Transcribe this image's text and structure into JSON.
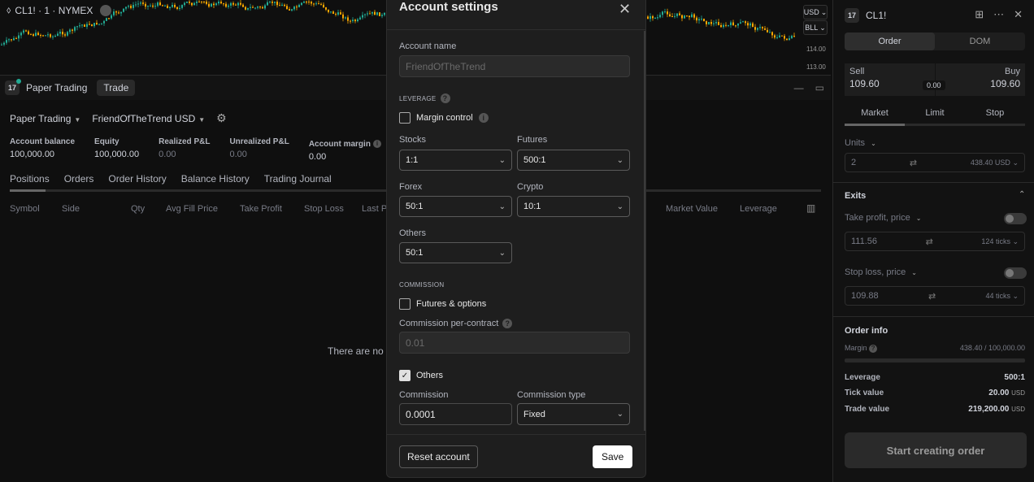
{
  "chart": {
    "symbol": "CL1! · 1 · NYMEX",
    "currency_btn": "USD",
    "unit_btn": "BLL",
    "price_ticks": [
      "114.00",
      "113.00"
    ]
  },
  "panel": {
    "title": "Paper Trading",
    "trade_tab": "Trade",
    "account_type": "Paper Trading",
    "account_name": "FriendOfTheTrend USD",
    "stats": [
      {
        "label": "Account balance",
        "value": "100,000.00",
        "dim": false
      },
      {
        "label": "Equity",
        "value": "100,000.00",
        "dim": false
      },
      {
        "label": "Realized P&L",
        "value": "0.00",
        "dim": true
      },
      {
        "label": "Unrealized P&L",
        "value": "0.00",
        "dim": true
      },
      {
        "label": "Account margin",
        "value": "0.00",
        "dim": false
      }
    ],
    "tabs": [
      "Positions",
      "Orders",
      "Order History",
      "Balance History",
      "Trading Journal"
    ],
    "columns": [
      "Symbol",
      "Side",
      "Qty",
      "Avg Fill Price",
      "Take Profit",
      "Stop Loss",
      "Last P",
      "Market Value",
      "Leverage"
    ],
    "empty_text": "There are no c"
  },
  "order": {
    "symbol": "CL1!",
    "segments": [
      "Order",
      "DOM"
    ],
    "sell_label": "Sell",
    "sell_price": "109.60",
    "buy_label": "Buy",
    "buy_price": "109.60",
    "spread": "0.00",
    "order_types": [
      "Market",
      "Limit",
      "Stop"
    ],
    "units_label": "Units",
    "units_value": "2",
    "units_suffix": "438.40",
    "units_currency": "USD",
    "exits_label": "Exits",
    "tp_label": "Take profit, price",
    "tp_value": "111.56",
    "tp_ticks": "124 ticks",
    "sl_label": "Stop loss, price",
    "sl_value": "109.88",
    "sl_ticks": "44 ticks",
    "info_title": "Order info",
    "margin_label": "Margin",
    "margin_value": "438.40 / 100,000.00",
    "leverage_label": "Leverage",
    "leverage_value": "500:1",
    "tick_label": "Tick value",
    "tick_value": "20.00",
    "trade_label": "Trade value",
    "trade_value": "219,200.00",
    "currency": "USD",
    "start_btn": "Start creating order"
  },
  "modal": {
    "title": "Account settings",
    "account_name_label": "Account name",
    "account_name_value": "FriendOfTheTrend",
    "leverage_section": "LEVERAGE",
    "margin_control": "Margin control",
    "stocks_label": "Stocks",
    "stocks_value": "1:1",
    "futures_label": "Futures",
    "futures_value": "500:1",
    "forex_label": "Forex",
    "forex_value": "50:1",
    "crypto_label": "Crypto",
    "crypto_value": "10:1",
    "others_label": "Others",
    "others_value": "50:1",
    "commission_section": "COMMISSION",
    "futures_options": "Futures & options",
    "commission_per_contract": "Commission per-contract",
    "commission_per_contract_placeholder": "0.01",
    "others_cb": "Others",
    "commission_label": "Commission",
    "commission_value": "0.0001",
    "commission_type_label": "Commission type",
    "commission_type_value": "Fixed",
    "reset_btn": "Reset account",
    "save_btn": "Save"
  }
}
